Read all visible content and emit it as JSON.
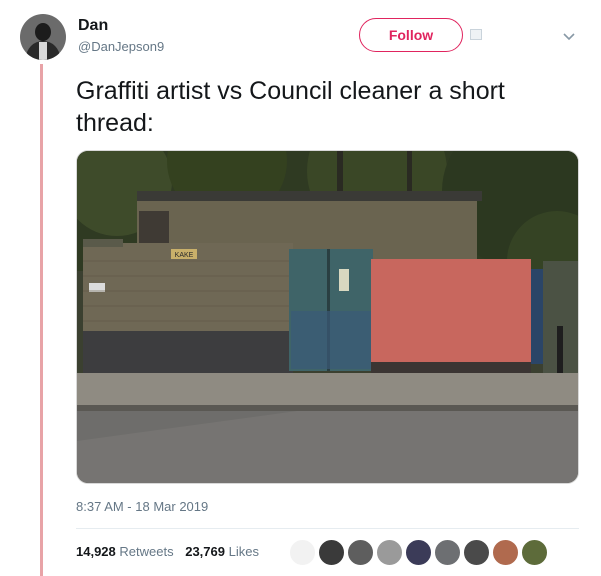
{
  "user": {
    "name": "Dan",
    "handle": "@DanJepson9",
    "follow_label": "Follow",
    "avatar_icon": "user-avatar-icon"
  },
  "tweet": {
    "text": "Graffiti artist vs Council cleaner a short thread:",
    "timestamp": "8:37 AM - 18 Mar 2019"
  },
  "stats": {
    "retweets_count": "14,928",
    "retweets_label": "Retweets",
    "likes_count": "23,769",
    "likes_label": "Likes"
  },
  "likers": {
    "count_shown": 9,
    "colors": [
      "#f2f2f2",
      "#3a3a3a",
      "#5e5e5e",
      "#9a9a9a",
      "#3b3b58",
      "#6d6f72",
      "#4a4a4a",
      "#b06a4e",
      "#5d6b3a"
    ]
  },
  "colors": {
    "accent": "#e0245e",
    "thread_line": "#e8a3a7",
    "secondary_text": "#657786"
  },
  "photo": {
    "sign_text": "KAKE"
  }
}
